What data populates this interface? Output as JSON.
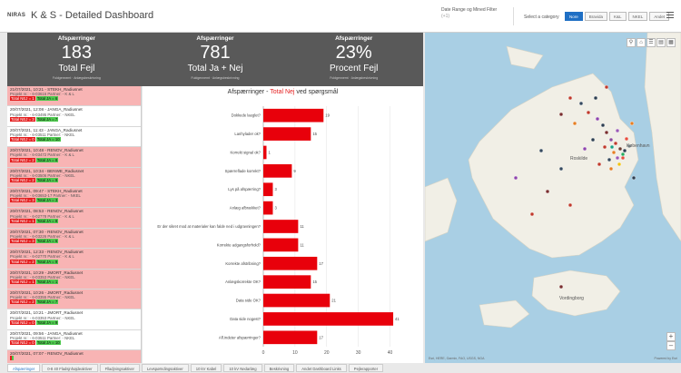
{
  "header": {
    "logo": "NIRAS",
    "title": "K & S - Detailed Dashboard",
    "date_filter_label": "Date Range og Mined Filter",
    "date_filter_sub": "(+1)",
    "category_label": "Select a category",
    "category_buttons": [
      "Nore",
      "Bravida",
      "K&L",
      "NKEL",
      "Andet"
    ]
  },
  "kpis": [
    {
      "top": "Afspærringer",
      "value": "183",
      "label": "Total Fejl",
      "foot": "Fuldgennemt · Anlægsbeskrivning"
    },
    {
      "top": "Afspærringer",
      "value": "781",
      "label": "Total Ja + Nej",
      "foot": "Fuldgennemt · Anlægsbeskrivning"
    },
    {
      "top": "Afspærringer",
      "value": "23%",
      "label": "Procent Fejl",
      "foot": "Fuldgennemt · Anlægsbeskrivning"
    }
  ],
  "list": [
    {
      "title": "21/07/2021, 10:21 - STEKH_Radiusnet",
      "line1": "Projekt nr.: - 6-03616 Partner: - K & L",
      "nej": "Total NEJ = 1",
      "ja": "Total JA = 6",
      "red": true
    },
    {
      "title": "20/07/2021, 12:08 - JANGA_Radiusnet",
      "line1": "Projekt nr.: - 6-03495 Partner: - NKEL",
      "nej": "Total NEJ = 3",
      "ja": "Total JA = 7",
      "red": false
    },
    {
      "title": "20/07/2021, 11:43 - JANGA_Radiusnet",
      "line1": "Projekt nr.: - 6-03511 Partner: - NKEL",
      "nej": "Total NEJ = 0",
      "ja": "Total JA = 10",
      "red": false
    },
    {
      "title": "20/07/2021, 10:48 - RENOV_Radiusnet",
      "line1": "Projekt nr.: - 6-03472 Partner: - K & L",
      "nej": "Total NEJ = 2",
      "ja": "Total JA = 8",
      "red": true
    },
    {
      "title": "20/07/2021, 10:34 - BENWE_Radiusnet",
      "line1": "Projekt nr.: - 6-03506 Partner: - NKEL",
      "nej": "Total NEJ = 2",
      "ja": "Total JA = 9",
      "red": true
    },
    {
      "title": "20/07/2021, 09:47 - STEKH_Radiusnet",
      "line1": "Projekt nr.: - 6-03653-17 Partner: - NKEL",
      "nej": "Total NEJ = 3",
      "ja": "Total JA = 3",
      "red": true
    },
    {
      "title": "20/07/2021, 08:53 - RENOV_Radiusnet",
      "line1": "Projekt nr.: - 6-02778 Partner: - K & L",
      "nej": "Total NEJ = 1",
      "ja": "Total JA = 8",
      "red": true
    },
    {
      "title": "20/07/2021, 07:30 - RENOV_Radiusnet",
      "line1": "Projekt nr.: - 6-03226 Partner: - K & L",
      "nej": "Total NEJ = 3",
      "ja": "Total JA = 6",
      "red": true
    },
    {
      "title": "20/07/2021, 12:33 - RENOV_Radiusnet",
      "line1": "Projekt nr.: - 6-02770 Partner: - K & L",
      "nej": "Total NEJ = 2",
      "ja": "Total JA = 9",
      "red": true
    },
    {
      "title": "20/07/2021, 10:29 - JMORT_Radiusnet",
      "line1": "Projekt nr.: - 6-03353 Partner: - NKEL",
      "nej": "Total NEJ = 1",
      "ja": "Total JA = 1",
      "red": true
    },
    {
      "title": "20/07/2021, 10:26 - JMORT_Radiusnet",
      "line1": "Projekt nr.: - 6-03355 Partner: - NKEL",
      "nej": "Total NEJ = 2",
      "ja": "Total JA = 7",
      "red": true
    },
    {
      "title": "20/07/2021, 10:21 - JMORT_Radiusnet",
      "line1": "Projekt nr.: - 6-03353 Partner: - NKEL",
      "nej": "Total NEJ = 0",
      "ja": "Total JA = 9",
      "red": false
    },
    {
      "title": "20/07/2021, 09:56 - JANGA_Radiusnet",
      "line1": "Projekt nr.: - 6-03511 Partner: - NKEL",
      "nej": "Total NEJ = 0",
      "ja": "Total JA = 10",
      "red": false
    },
    {
      "title": "20/07/2021, 07:07 - RENOV_Radiusnet",
      "line1": "",
      "nej": "",
      "ja": "",
      "red": true
    }
  ],
  "chart_title_prefix": "Afspærringer - ",
  "chart_title_accent": "Total Nej",
  "chart_title_suffix": " ved spørgsmål",
  "chart_data": {
    "type": "bar",
    "orientation": "horizontal",
    "categories": [
      "Dokkede laeglet?",
      "Lanhylader ok?",
      "Korrekt signal ok?",
      "Spærreflade korrekt?",
      "Lys på afspærring?",
      "Anlæg afbrækket?",
      "Er der sikret mod at materialer kan falde ned i udgravningen?",
      "Korrekte adgangsforhold?",
      "Korrekte afstribning?",
      "Anlægskorrekte OK?",
      "Data side OK?",
      "Data side nogest?",
      "Afl.indeter afspærringer?"
    ],
    "values": [
      19,
      15,
      1,
      9,
      3,
      3,
      11,
      11,
      17,
      15,
      21,
      41,
      17
    ],
    "xlim": [
      0,
      45
    ],
    "xticks": [
      0,
      10,
      20,
      30,
      40
    ],
    "color": "#e8000b"
  },
  "map": {
    "attribution": "Esri, HERE, Garmin, FAO, USGS, NGA",
    "powered": "Powered by Esri",
    "place_labels": [
      "København",
      "Roskilde",
      "Vordingborg"
    ],
    "tool_icons": [
      "search-icon",
      "home-icon",
      "layers-icon",
      "legend-icon",
      "basemap-icon"
    ]
  },
  "tabs": [
    "Afspærringer",
    "0-8 40 Fladsjnhøjdeaktiver",
    "Flladjningsaktiver",
    "Levspørndingsaktiver",
    "10 kV Kabel",
    "10 kV Nedarlæg",
    "Beskrivning",
    "Andet Dashboard Links",
    "Pejlerapporter"
  ],
  "colors": {
    "kpi_bg": "#595959",
    "bar_red": "#e8000b",
    "row_red": "#f8b4b4",
    "ja_green": "#4ec94e",
    "accent_blue": "#1f6fc4",
    "map_water": "#a9cfe4",
    "map_land": "#f1efe6"
  }
}
